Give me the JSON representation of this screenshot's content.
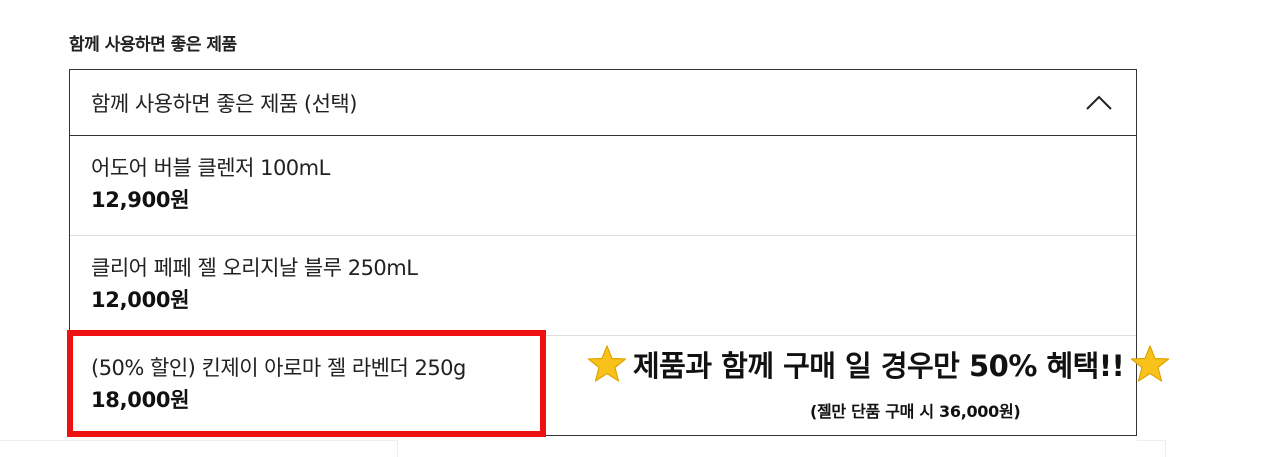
{
  "section": {
    "title": "함께 사용하면 좋은 제품"
  },
  "dropdown": {
    "placeholder": "함께 사용하면 좋은 제품 (선택)",
    "expanded": true,
    "options": [
      {
        "name": "어도어 버블 클렌저 100mL",
        "price": "12,900원"
      },
      {
        "name": "클리어 페페 젤 오리지날 블루 250mL",
        "price": "12,000원"
      },
      {
        "name": "(50% 할인) 킨제이 아로마 젤 라벤더 250g",
        "price": "18,000원"
      }
    ]
  },
  "promo": {
    "headline": "제품과 함께 구매 일 경우만 50% 혜택!!",
    "note": "(젤만 단품 구매 시 36,000원)",
    "icon": "star-icon"
  },
  "colors": {
    "highlight": "#ee1111",
    "star": "#f9c21b",
    "border": "#333333"
  }
}
